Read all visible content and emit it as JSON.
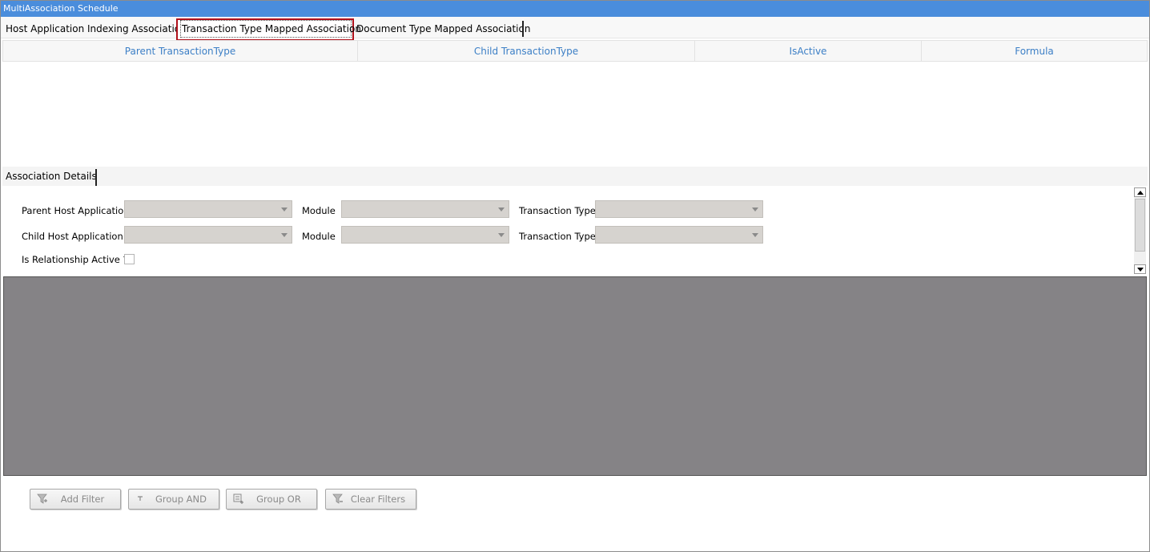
{
  "window": {
    "title": "MultiAssociation Schedule"
  },
  "tabs": [
    {
      "label": "Host Application Indexing Association"
    },
    {
      "label": "Transaction Type Mapped Association",
      "selected": true
    },
    {
      "label": "Document Type Mapped Association"
    }
  ],
  "grid": {
    "columns": [
      "Parent TransactionType",
      "Child TransactionType",
      "IsActive",
      "Formula"
    ],
    "rows": []
  },
  "details": {
    "tab_label": "Association Details",
    "parent_host_label": "Parent Host Application",
    "parent_module_label": "Module",
    "parent_txn_label": "Transaction Type",
    "child_host_label": "Child Host Application",
    "child_module_label": "Module",
    "child_txn_label": "Transaction Type",
    "active_label": "Is Relationship Active ?",
    "active_checked": false
  },
  "filter_buttons": {
    "add_filter": "Add Filter",
    "group_and": "Group AND",
    "group_or": "Group OR",
    "clear_filters": "Clear Filters"
  },
  "colors": {
    "titlebar": "#4a8ddc",
    "column_header_text": "#3c7fc6",
    "selected_tab_border": "#b0101a",
    "panel_gray": "#858386",
    "combo_disabled": "#d6d3cf"
  }
}
